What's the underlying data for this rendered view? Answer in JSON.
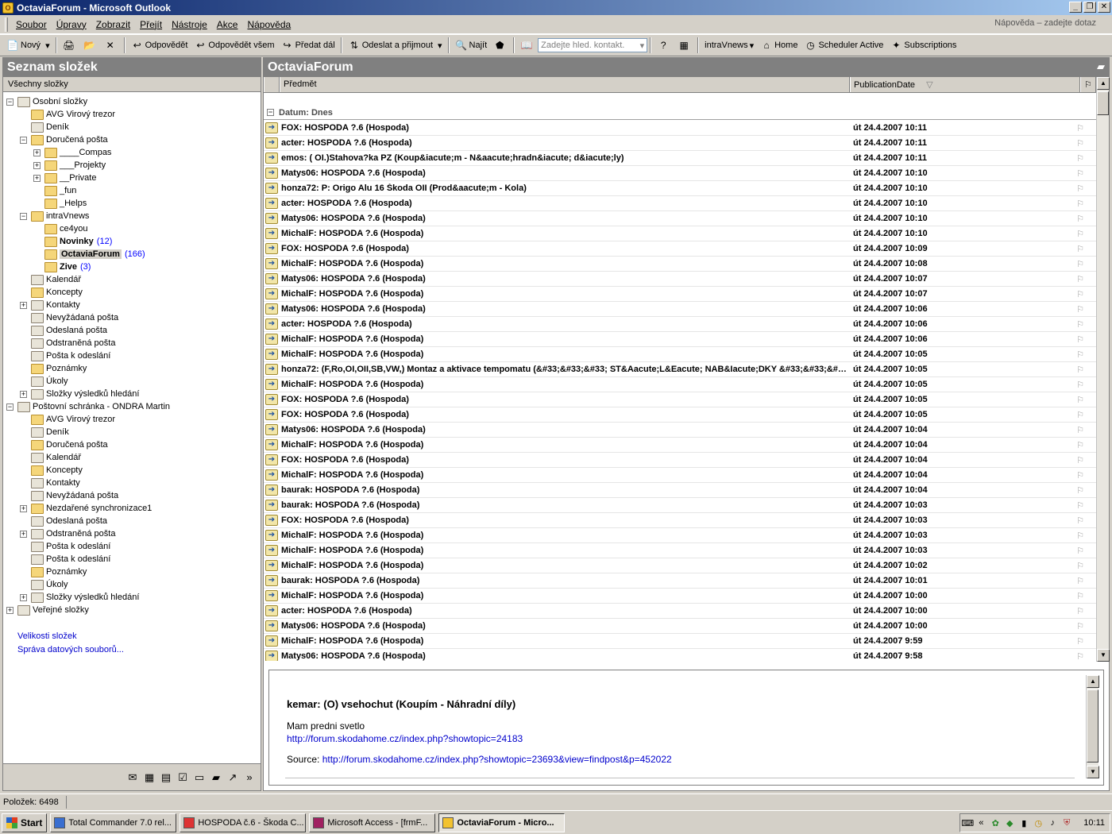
{
  "window": {
    "title": "OctaviaForum - Microsoft Outlook"
  },
  "menu": {
    "items": [
      "Soubor",
      "Úpravy",
      "Zobrazit",
      "Přejít",
      "Nástroje",
      "Akce",
      "Nápověda"
    ],
    "help_placeholder": "Nápověda – zadejte dotaz"
  },
  "toolbar": {
    "new": "Nový",
    "reply": "Odpovědět",
    "reply_all": "Odpovědět všem",
    "forward": "Předat dál",
    "send_receive": "Odeslat a přijmout",
    "find": "Najít",
    "contact_search_placeholder": "Zadejte hled. kontakt.",
    "intravnews": "intraVnews",
    "home": "Home",
    "scheduler": "Scheduler Active",
    "subscriptions": "Subscriptions"
  },
  "folders": {
    "pane_title": "Seznam složek",
    "subheader": "Všechny složky",
    "tree": [
      {
        "label": "Osobní složky",
        "depth": 0,
        "exp": "-",
        "special": true
      },
      {
        "label": "AVG Virový trezor",
        "depth": 1
      },
      {
        "label": "Deník",
        "depth": 1,
        "special": true
      },
      {
        "label": "Doručená pošta",
        "depth": 1,
        "exp": "-"
      },
      {
        "label": "____Compas",
        "depth": 2,
        "exp": "+"
      },
      {
        "label": "___Projekty",
        "depth": 2,
        "exp": "+"
      },
      {
        "label": "__Private",
        "depth": 2,
        "exp": "+"
      },
      {
        "label": "_fun",
        "depth": 2
      },
      {
        "label": "_Helps",
        "depth": 2
      },
      {
        "label": "intraVnews",
        "depth": 1,
        "exp": "-"
      },
      {
        "label": "ce4you",
        "depth": 2
      },
      {
        "label": "Novinky",
        "depth": 2,
        "count": "(12)",
        "bold": true
      },
      {
        "label": "OctaviaForum",
        "depth": 2,
        "count": "(166)",
        "bold": true,
        "selected": true
      },
      {
        "label": "Zive",
        "depth": 2,
        "count": "(3)",
        "bold": true
      },
      {
        "label": "Kalendář",
        "depth": 1,
        "special": true
      },
      {
        "label": "Koncepty",
        "depth": 1
      },
      {
        "label": "Kontakty",
        "depth": 1,
        "exp": "+",
        "special": true
      },
      {
        "label": "Nevyžádaná pošta",
        "depth": 1,
        "special": true
      },
      {
        "label": "Odeslaná pošta",
        "depth": 1,
        "special": true
      },
      {
        "label": "Odstraněná pošta",
        "depth": 1,
        "special": true
      },
      {
        "label": "Pošta k odeslání",
        "depth": 1,
        "special": true
      },
      {
        "label": "Poznámky",
        "depth": 1
      },
      {
        "label": "Úkoly",
        "depth": 1,
        "special": true
      },
      {
        "label": "Složky výsledků hledání",
        "depth": 1,
        "exp": "+",
        "special": true
      },
      {
        "label": "Poštovní schránka - ONDRA Martin",
        "depth": 0,
        "exp": "-",
        "special": true
      },
      {
        "label": "AVG Virový trezor",
        "depth": 1
      },
      {
        "label": "Deník",
        "depth": 1,
        "special": true
      },
      {
        "label": "Doručená pošta",
        "depth": 1
      },
      {
        "label": "Kalendář",
        "depth": 1,
        "special": true
      },
      {
        "label": "Koncepty",
        "depth": 1
      },
      {
        "label": "Kontakty",
        "depth": 1,
        "special": true
      },
      {
        "label": "Nevyžádaná pošta",
        "depth": 1,
        "special": true
      },
      {
        "label": "Nezdařené synchronizace1",
        "depth": 1,
        "exp": "+"
      },
      {
        "label": "Odeslaná pošta",
        "depth": 1,
        "special": true
      },
      {
        "label": "Odstraněná pošta",
        "depth": 1,
        "exp": "+",
        "special": true
      },
      {
        "label": "Pošta k odeslání",
        "depth": 1,
        "special": true
      },
      {
        "label": "Pošta k odeslání",
        "depth": 1,
        "special": true
      },
      {
        "label": "Poznámky",
        "depth": 1
      },
      {
        "label": "Úkoly",
        "depth": 1,
        "special": true
      },
      {
        "label": "Složky výsledků hledání",
        "depth": 1,
        "exp": "+",
        "special": true
      },
      {
        "label": "Veřejné složky",
        "depth": 0,
        "exp": "+",
        "special": true
      }
    ],
    "links": [
      "Velikosti složek",
      "Správa datových souborů..."
    ]
  },
  "messages": {
    "pane_title": "OctaviaForum",
    "col_subject": "Předmět",
    "col_date": "PublicationDate",
    "group_label": "Datum: Dnes",
    "rows": [
      {
        "subject": "FOX: HOSPODA ?.6 (Hospoda)",
        "date": "út 24.4.2007 10:11"
      },
      {
        "subject": "acter: HOSPODA ?.6 (Hospoda)",
        "date": "út 24.4.2007 10:11"
      },
      {
        "subject": "emos: ( OI.)Stahova?ka PZ (Koup&iacute;m - N&aacute;hradn&iacute; d&iacute;ly)",
        "date": "út 24.4.2007 10:11"
      },
      {
        "subject": "Matys06: HOSPODA ?.6 (Hospoda)",
        "date": "út 24.4.2007 10:10"
      },
      {
        "subject": "honza72: P: Origo Alu 16 Škoda OII (Prod&aacute;m - Kola)",
        "date": "út 24.4.2007 10:10"
      },
      {
        "subject": "acter: HOSPODA ?.6 (Hospoda)",
        "date": "út 24.4.2007 10:10"
      },
      {
        "subject": "Matys06: HOSPODA ?.6 (Hospoda)",
        "date": "út 24.4.2007 10:10"
      },
      {
        "subject": "MichalF: HOSPODA ?.6 (Hospoda)",
        "date": "út 24.4.2007 10:10"
      },
      {
        "subject": "FOX: HOSPODA ?.6 (Hospoda)",
        "date": "út 24.4.2007 10:09"
      },
      {
        "subject": "MichalF: HOSPODA ?.6 (Hospoda)",
        "date": "út 24.4.2007 10:08"
      },
      {
        "subject": "Matys06: HOSPODA ?.6 (Hospoda)",
        "date": "út 24.4.2007 10:07"
      },
      {
        "subject": "MichalF: HOSPODA ?.6 (Hospoda)",
        "date": "út 24.4.2007 10:07"
      },
      {
        "subject": "Matys06: HOSPODA ?.6 (Hospoda)",
        "date": "út 24.4.2007 10:06"
      },
      {
        "subject": "acter: HOSPODA ?.6 (Hospoda)",
        "date": "út 24.4.2007 10:06"
      },
      {
        "subject": "MichalF: HOSPODA ?.6 (Hospoda)",
        "date": "út 24.4.2007 10:06"
      },
      {
        "subject": "MichalF: HOSPODA ?.6 (Hospoda)",
        "date": "út 24.4.2007 10:05"
      },
      {
        "subject": "honza72: (F,Ro,OI,OII,SB,VW,) Montaz a aktivace tempomatu (&#33;&#33;&#33; ST&Aacute;L&Eacute; NAB&Iacute;DKY &#33;&#33;&#33;)",
        "date": "út 24.4.2007 10:05"
      },
      {
        "subject": "MichalF: HOSPODA ?.6 (Hospoda)",
        "date": "út 24.4.2007 10:05"
      },
      {
        "subject": "FOX: HOSPODA ?.6 (Hospoda)",
        "date": "út 24.4.2007 10:05"
      },
      {
        "subject": "FOX: HOSPODA ?.6 (Hospoda)",
        "date": "út 24.4.2007 10:05"
      },
      {
        "subject": "Matys06: HOSPODA ?.6 (Hospoda)",
        "date": "út 24.4.2007 10:04"
      },
      {
        "subject": "MichalF: HOSPODA ?.6 (Hospoda)",
        "date": "út 24.4.2007 10:04"
      },
      {
        "subject": "FOX: HOSPODA ?.6 (Hospoda)",
        "date": "út 24.4.2007 10:04"
      },
      {
        "subject": "MichalF: HOSPODA ?.6 (Hospoda)",
        "date": "út 24.4.2007 10:04"
      },
      {
        "subject": "baurak: HOSPODA ?.6 (Hospoda)",
        "date": "út 24.4.2007 10:04"
      },
      {
        "subject": "baurak: HOSPODA ?.6 (Hospoda)",
        "date": "út 24.4.2007 10:03"
      },
      {
        "subject": "FOX: HOSPODA ?.6 (Hospoda)",
        "date": "út 24.4.2007 10:03"
      },
      {
        "subject": "MichalF: HOSPODA ?.6 (Hospoda)",
        "date": "út 24.4.2007 10:03"
      },
      {
        "subject": "MichalF: HOSPODA ?.6 (Hospoda)",
        "date": "út 24.4.2007 10:03"
      },
      {
        "subject": "MichalF: HOSPODA ?.6 (Hospoda)",
        "date": "út 24.4.2007 10:02"
      },
      {
        "subject": "baurak: HOSPODA ?.6 (Hospoda)",
        "date": "út 24.4.2007 10:01"
      },
      {
        "subject": "MichalF: HOSPODA ?.6 (Hospoda)",
        "date": "út 24.4.2007 10:00"
      },
      {
        "subject": "acter: HOSPODA ?.6 (Hospoda)",
        "date": "út 24.4.2007 10:00"
      },
      {
        "subject": "Matys06: HOSPODA ?.6 (Hospoda)",
        "date": "út 24.4.2007 10:00"
      },
      {
        "subject": "MichalF: HOSPODA ?.6 (Hospoda)",
        "date": "út 24.4.2007 9:59"
      },
      {
        "subject": "Matys06: HOSPODA ?.6 (Hospoda)",
        "date": "út 24.4.2007 9:58"
      }
    ]
  },
  "preview": {
    "title": "kemar: (O) vsehochut (Koupím - Náhradní díly)",
    "body_text": "Mam predni svetlo",
    "body_link": "http://forum.skodahome.cz/index.php?showtopic=24183",
    "source_label": "Source:",
    "source_link": "http://forum.skodahome.cz/index.php?showtopic=23693&view=findpost&p=452022"
  },
  "status": {
    "items_count": "Položek: 6498"
  },
  "taskbar": {
    "start": "Start",
    "buttons": [
      {
        "label": "Total Commander 7.0 rel...",
        "active": false
      },
      {
        "label": "HOSPODA č.6 - Škoda C...",
        "active": false
      },
      {
        "label": "Microsoft Access - [frmF...",
        "active": false
      },
      {
        "label": "OctaviaForum - Micro...",
        "active": true
      }
    ],
    "clock": "10:11"
  }
}
